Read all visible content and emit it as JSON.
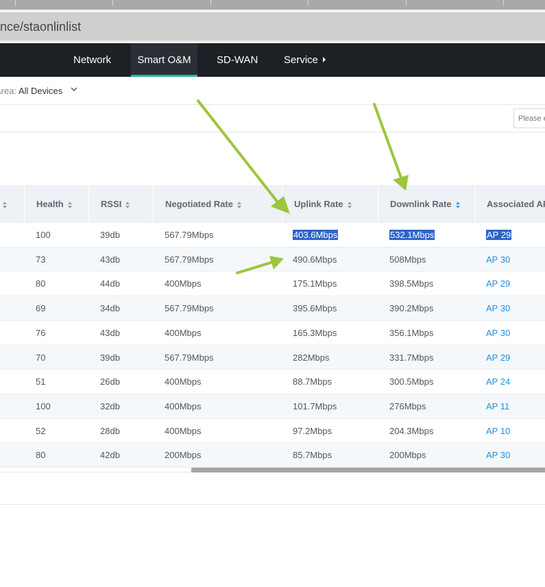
{
  "browser": {
    "url_text": "nce/staonlinlist"
  },
  "nav": {
    "items": [
      {
        "label": "Network"
      },
      {
        "label": "Smart O&M",
        "active": true
      },
      {
        "label": "SD-WAN"
      },
      {
        "label": "Service"
      }
    ]
  },
  "filter": {
    "area_label": "Area:",
    "area_value": "All Devices"
  },
  "search": {
    "placeholder": "Please enter"
  },
  "table": {
    "columns": [
      "Health",
      "RSSI",
      "Negotiated Rate",
      "Uplink Rate",
      "Downlink Rate",
      "Associated AP"
    ],
    "rows": [
      {
        "health": "100",
        "rssi": "39db",
        "negotiated": "567.79Mbps",
        "uplink": "403.6Mbps",
        "downlink": "532.1Mbps",
        "ap": "AP 29"
      },
      {
        "health": "73",
        "rssi": "43db",
        "negotiated": "567.79Mbps",
        "uplink": "490.6Mbps",
        "downlink": "508Mbps",
        "ap": "AP 30"
      },
      {
        "health": "80",
        "rssi": "44db",
        "negotiated": "400Mbps",
        "uplink": "175.1Mbps",
        "downlink": "398.5Mbps",
        "ap": "AP 29"
      },
      {
        "health": "69",
        "rssi": "34db",
        "negotiated": "567.79Mbps",
        "uplink": "395.6Mbps",
        "downlink": "390.2Mbps",
        "ap": "AP 30"
      },
      {
        "health": "76",
        "rssi": "43db",
        "negotiated": "400Mbps",
        "uplink": "165.3Mbps",
        "downlink": "356.1Mbps",
        "ap": "AP 30"
      },
      {
        "health": "70",
        "rssi": "39db",
        "negotiated": "567.79Mbps",
        "uplink": "282Mbps",
        "downlink": "331.7Mbps",
        "ap": "AP 29"
      },
      {
        "health": "51",
        "rssi": "26db",
        "negotiated": "400Mbps",
        "uplink": "88.7Mbps",
        "downlink": "300.5Mbps",
        "ap": "AP 24"
      },
      {
        "health": "100",
        "rssi": "32db",
        "negotiated": "400Mbps",
        "uplink": "101.7Mbps",
        "downlink": "276Mbps",
        "ap": "AP 11"
      },
      {
        "health": "52",
        "rssi": "28db",
        "negotiated": "400Mbps",
        "uplink": "97.2Mbps",
        "downlink": "204.3Mbps",
        "ap": "AP 10"
      },
      {
        "health": "80",
        "rssi": "42db",
        "negotiated": "200Mbps",
        "uplink": "85.7Mbps",
        "downlink": "200Mbps",
        "ap": "AP 30"
      }
    ]
  },
  "colors": {
    "nav_bg": "#1d2025",
    "active_tab_underline": "#1fb7a6",
    "link": "#1e90e0",
    "selection": "#2f64c8",
    "annotation_arrow": "#9cc63b"
  }
}
